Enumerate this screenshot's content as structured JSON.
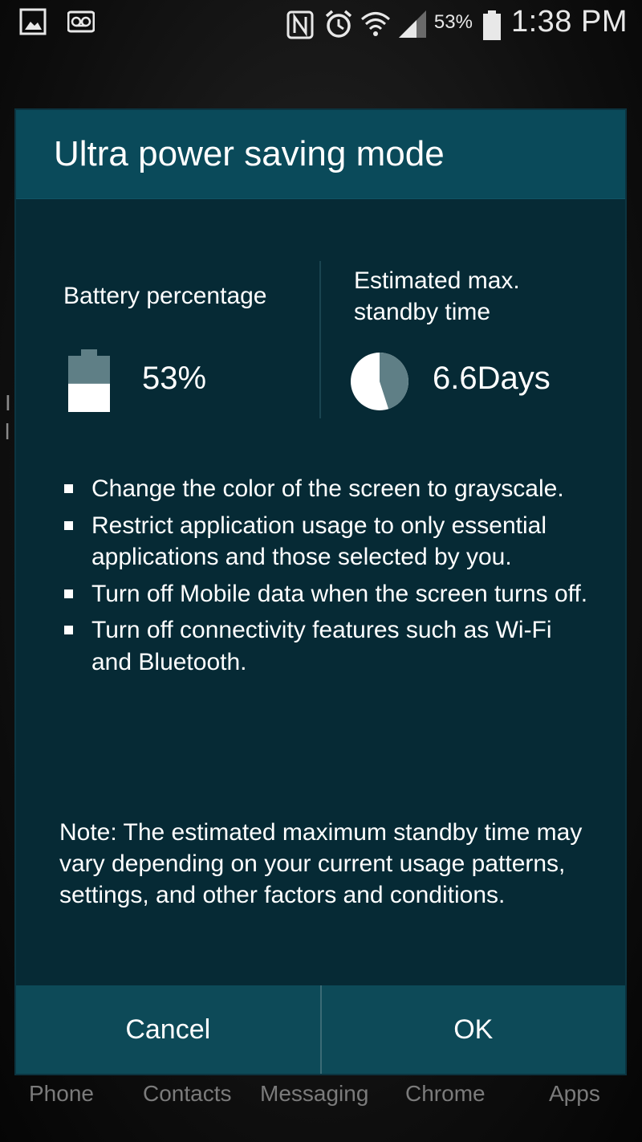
{
  "status_bar": {
    "left_icons": [
      "gallery-icon",
      "voicemail-icon"
    ],
    "right_icons": [
      "nfc-icon",
      "alarm-icon",
      "wifi-icon",
      "signal-icon",
      "battery-icon"
    ],
    "battery_percent": "53%",
    "time": "1:38 PM"
  },
  "dialog": {
    "title": "Ultra power saving mode",
    "battery": {
      "label": "Battery percentage",
      "value": "53%",
      "level": 0.53
    },
    "standby": {
      "label_line1": "Estimated max.",
      "label_line2": "standby time",
      "value": "6.6Days",
      "pie_fraction_remaining": 0.45
    },
    "bullets": [
      "Change the color of the screen to grayscale.",
      "Restrict application usage to only essential applications and those selected by you.",
      "Turn off Mobile data when the screen turns off.",
      "Turn off connectivity features such as Wi-Fi and Bluetooth."
    ],
    "note": "Note: The estimated maximum standby time may vary depending on your current usage patterns, settings, and other factors and conditions.",
    "buttons": {
      "cancel": "Cancel",
      "ok": "OK"
    }
  },
  "dock": {
    "items": [
      "Phone",
      "Contacts",
      "Messaging",
      "Chrome",
      "Apps"
    ]
  },
  "colors": {
    "dialog_bg": "#062a35",
    "header_bg": "#0a4a5a",
    "button_bar_bg": "#0d4a58",
    "battery_empty": "#5f7f86",
    "battery_fill": "#ffffff",
    "pie_remaining": "#5f7f86"
  }
}
